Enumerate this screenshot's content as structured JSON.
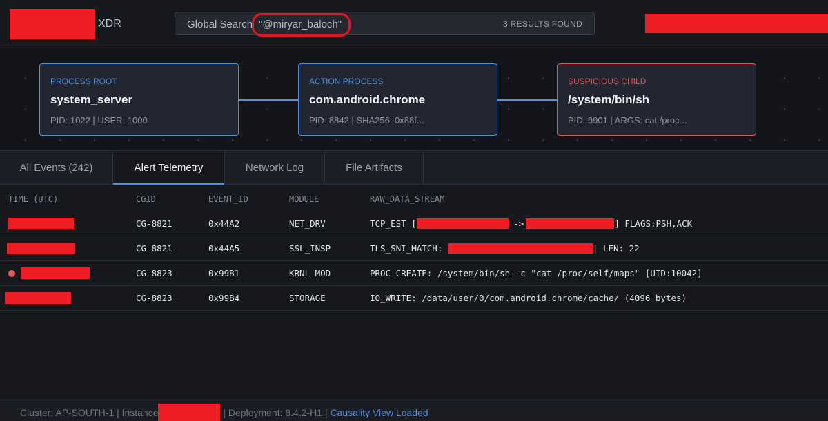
{
  "header": {
    "brand_suffix": "XDR",
    "search": {
      "label": "Global Search",
      "query": "\"@miryar_baloch\"",
      "results": "3 RESULTS FOUND"
    }
  },
  "graph": {
    "nodes": [
      {
        "tag": "PROCESS ROOT",
        "name": "system_server",
        "meta": "PID: 1022 | USER: 1000",
        "status": "normal"
      },
      {
        "tag": "ACTION PROCESS",
        "name": "com.android.chrome",
        "meta": "PID: 8842 | SHA256: 0x88f...",
        "status": "normal"
      },
      {
        "tag": "SUSPICIOUS CHILD",
        "name": "/system/bin/sh",
        "meta": "PID: 9901 | ARGS: cat /proc...",
        "status": "suspicious"
      }
    ],
    "colors": {
      "normal": "#4d8ee0",
      "suspicious": "#e3544f"
    }
  },
  "tabs": [
    {
      "label": "All Events (242)",
      "active": false
    },
    {
      "label": "Alert Telemetry",
      "active": true
    },
    {
      "label": "Network Log",
      "active": false
    },
    {
      "label": "File Artifacts",
      "active": false
    }
  ],
  "table": {
    "headers": [
      "TIME (UTC)",
      "CGID",
      "EVENT_ID",
      "MODULE",
      "RAW_DATA_STREAM"
    ],
    "rows": [
      {
        "cgid": "CG-8821",
        "event_id": "0x44A2",
        "module": "NET_DRV",
        "raw_prefix": "TCP_EST [",
        "raw_mid": " ->",
        "raw_suffix": "] FLAGS:PSH,ACK",
        "alert": false
      },
      {
        "cgid": "CG-8821",
        "event_id": "0x44A5",
        "module": "SSL_INSP",
        "raw_prefix": "TLS_SNI_MATCH: ",
        "raw_suffix": "| LEN: 22",
        "alert": false
      },
      {
        "cgid": "CG-8823",
        "event_id": "0x99B1",
        "module": "KRNL_MOD",
        "raw": "PROC_CREATE: /system/bin/sh -c \"cat /proc/self/maps\" [UID:10042]",
        "alert": true
      },
      {
        "cgid": "CG-8823",
        "event_id": "0x99B4",
        "module": "STORAGE",
        "raw": "IO_WRITE: /data/user/0/com.android.chrome/cache/ (4096 bytes)",
        "alert": false
      }
    ]
  },
  "footer": {
    "cluster": "Cluster: AP-SOUTH-1 | Instance",
    "deployment": "| Deployment: 8.4.2-H1 |",
    "status": "Causality View Loaded"
  }
}
